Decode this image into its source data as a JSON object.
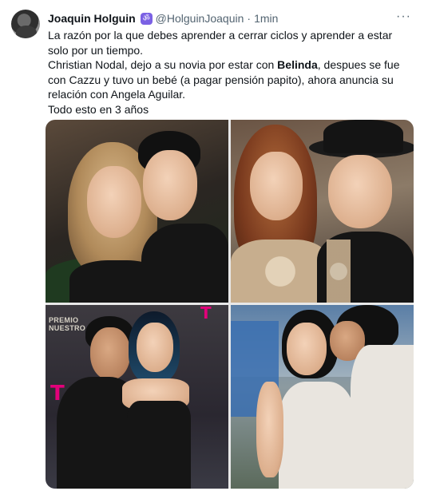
{
  "tweet": {
    "author_name": "Joaquin Holguin",
    "handle": "@HolguinJoaquin",
    "separator": "·",
    "time": "1min",
    "more_icon": "more-horizontal-icon",
    "badge_icon": "verified-badge-icon",
    "badge_glyph": "ॐ",
    "body": {
      "line1": "La razón por la que debes aprender a cerrar ciclos y aprender a estar solo por un tiempo.",
      "line2_before": "Christian Nodal, dejo a su novia por estar con ",
      "line2_bold": "Belinda",
      "line2_after": ", despues se fue con Cazzu y tuvo un bebé (a pagar pensión papito), ahora anuncia su relación con Angela Aguilar.",
      "line3": "Todo esto en 3 años"
    },
    "media": {
      "photo_count": 4,
      "logo_text": "T",
      "logo_text_2": "T",
      "logo_text_3": "T",
      "premio_line1": "PREMIO",
      "premio_line2": "NUESTRO"
    }
  }
}
